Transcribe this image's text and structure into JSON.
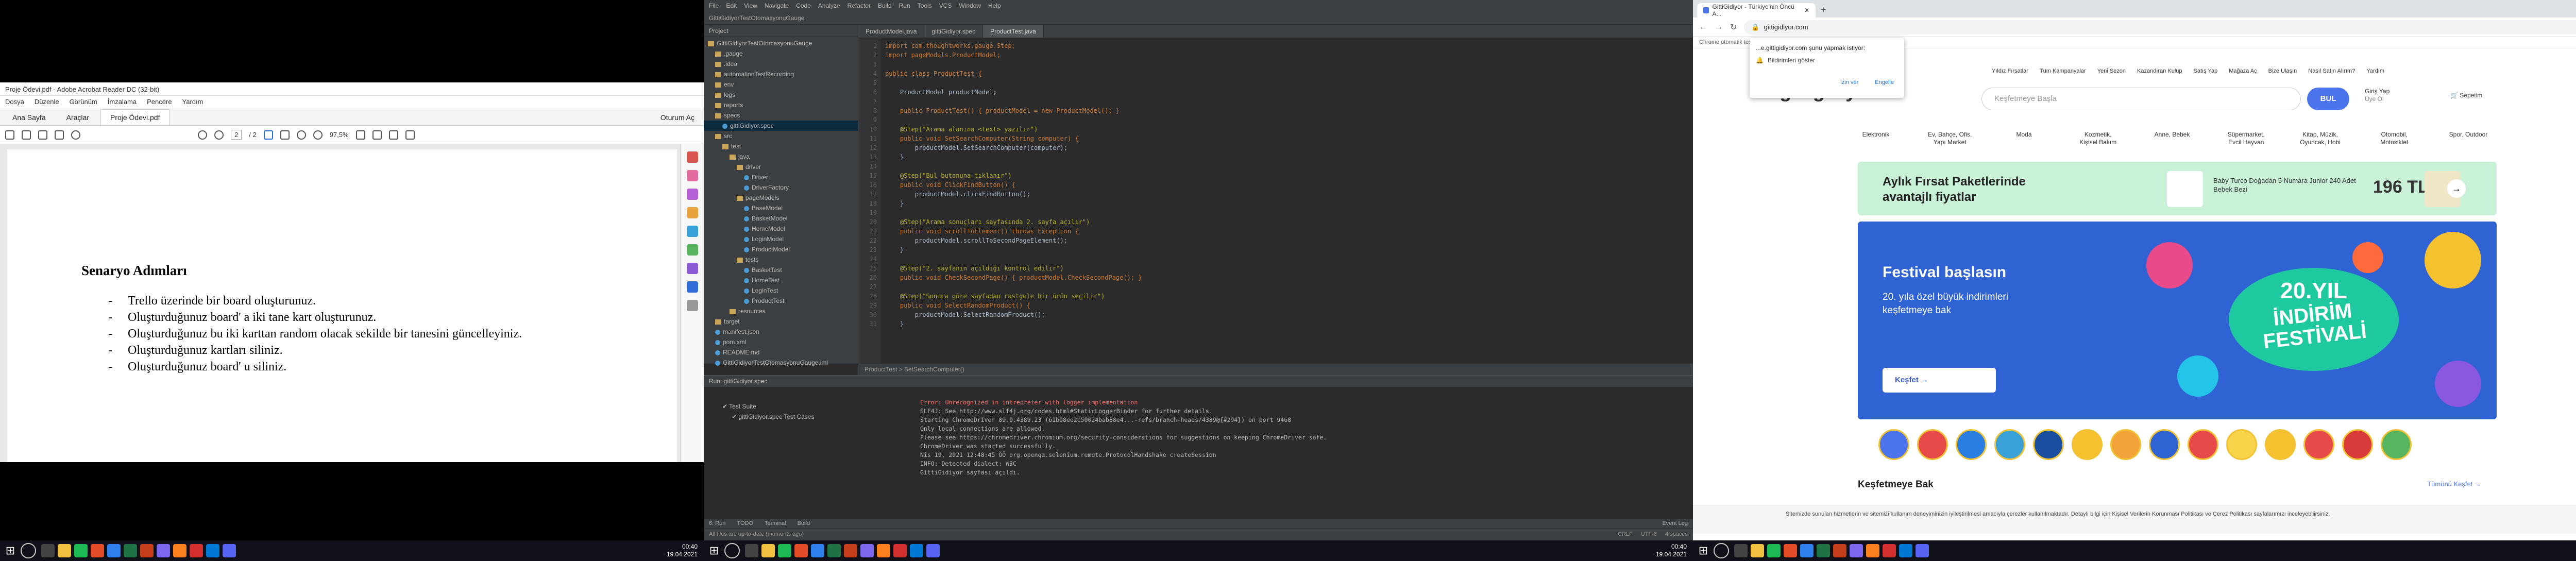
{
  "pdf": {
    "window_title": "Proje Ödevi.pdf - Adobe Acrobat Reader DC (32-bit)",
    "menu": [
      "Dosya",
      "Düzenle",
      "Görünüm",
      "İmzalama",
      "Pencere",
      "Yardım"
    ],
    "tabs": [
      "Ana Sayfa",
      "Araçlar",
      "Proje Ödevi.pdf"
    ],
    "signin": "Oturum Aç",
    "page_current": "2",
    "page_total": "/ 2",
    "zoom": "97,5%",
    "heading": "Senaryo Adımları",
    "steps": [
      "Trello üzerinde bir board oluşturunuz.",
      "Oluşturduğunuz board' a iki tane kart oluşturunuz.",
      "Oluşturduğunuz bu iki karttan random olacak sekilde bir tanesini güncelleyiniz.",
      "Oluşturduğunuz kartları siliniz.",
      "Oluşturduğunuz board' u siliniz."
    ],
    "bullet": "-"
  },
  "ide": {
    "menu": [
      "File",
      "Edit",
      "View",
      "Navigate",
      "Code",
      "Analyze",
      "Refactor",
      "Build",
      "Run",
      "Tools",
      "VCS",
      "Window",
      "Help"
    ],
    "nav": "GittiGidiyorTestOtomasyonuGauge",
    "project_label": "Project",
    "tree": [
      {
        "label": "GittiGidiyorTestOtomasyonuGauge",
        "type": "folder",
        "depth": 0
      },
      {
        "label": ".gauge",
        "type": "folder",
        "depth": 1
      },
      {
        "label": ".idea",
        "type": "folder",
        "depth": 1
      },
      {
        "label": "automationTestRecording",
        "type": "folder",
        "depth": 1
      },
      {
        "label": "env",
        "type": "folder",
        "depth": 1
      },
      {
        "label": "logs",
        "type": "folder",
        "depth": 1
      },
      {
        "label": "reports",
        "type": "folder",
        "depth": 1
      },
      {
        "label": "specs",
        "type": "folder",
        "depth": 1
      },
      {
        "label": "gittiGidiyor.spec",
        "type": "file",
        "depth": 2,
        "selected": true
      },
      {
        "label": "src",
        "type": "folder",
        "depth": 1
      },
      {
        "label": "test",
        "type": "folder",
        "depth": 2
      },
      {
        "label": "java",
        "type": "folder",
        "depth": 3
      },
      {
        "label": "driver",
        "type": "folder",
        "depth": 4
      },
      {
        "label": "Driver",
        "type": "file",
        "depth": 5
      },
      {
        "label": "DriverFactory",
        "type": "file",
        "depth": 5
      },
      {
        "label": "pageModels",
        "type": "folder",
        "depth": 4
      },
      {
        "label": "BaseModel",
        "type": "file",
        "depth": 5
      },
      {
        "label": "BasketModel",
        "type": "file",
        "depth": 5
      },
      {
        "label": "HomeModel",
        "type": "file",
        "depth": 5
      },
      {
        "label": "LoginModel",
        "type": "file",
        "depth": 5
      },
      {
        "label": "ProductModel",
        "type": "file",
        "depth": 5
      },
      {
        "label": "tests",
        "type": "folder",
        "depth": 4
      },
      {
        "label": "BasketTest",
        "type": "file",
        "depth": 5
      },
      {
        "label": "HomeTest",
        "type": "file",
        "depth": 5
      },
      {
        "label": "LoginTest",
        "type": "file",
        "depth": 5
      },
      {
        "label": "ProductTest",
        "type": "file",
        "depth": 5
      },
      {
        "label": "resources",
        "type": "folder",
        "depth": 3
      },
      {
        "label": "target",
        "type": "folder",
        "depth": 1
      },
      {
        "label": "manifest.json",
        "type": "file",
        "depth": 1
      },
      {
        "label": "pom.xml",
        "type": "file",
        "depth": 1
      },
      {
        "label": "README.md",
        "type": "file",
        "depth": 1
      },
      {
        "label": "GittiGidiyorTestOtomasyonuGauge.iml",
        "type": "file",
        "depth": 1
      }
    ],
    "tabs": [
      "ProductModel.java",
      "gittiGidiyor.spec",
      "ProductTest.java"
    ],
    "active_tab": 2,
    "code": [
      "import com.thoughtworks.gauge.Step;",
      "import pageModels.ProductModel;",
      "",
      "public class ProductTest {",
      "",
      "    ProductModel productModel;",
      "",
      "    public ProductTest() { productModel = new ProductModel(); }",
      "",
      "    @Step(\"Arama alanına <text> yazılır\")",
      "    public void SetSearchComputer(String computer) {",
      "        productModel.SetSearchComputer(computer);",
      "    }",
      "",
      "    @Step(\"Bul butonuna tıklanır\")",
      "    public void ClickFindButton() {",
      "        productModel.clickFindButton();",
      "    }",
      "",
      "    @Step(\"Arama sonuçları sayfasında 2. sayfa açılır\")",
      "    public void scrollToElement() throws Exception {",
      "        productModel.scrollToSecondPageElement();",
      "    }",
      "",
      "    @Step(\"2. sayfanın açıldığı kontrol edilir\")",
      "    public void CheckSecondPage() { productModel.CheckSecondPage(); }",
      "",
      "    @Step(\"Sonuca göre sayfadan rastgele bir ürün seçilir\")",
      "    public void SelectRandomProduct() {",
      "        productModel.SelectRandomProduct();",
      "    }"
    ],
    "breadcrumb": "ProductTest > SetSearchComputer()",
    "run_title": "Run: gittiGidiyor.spec",
    "run_tree": [
      "Test Suite",
      "gittiGidiyor.spec Test Cases"
    ],
    "run_output": [
      "Error: Unrecognized in intrepreter with logger implementation",
      "SLF4J: See http://www.slf4j.org/codes.html#StaticLoggerBinder for further details.",
      "Starting ChromeDriver 89.0.4389.23 (61b08ee2c50024bab88e4...-refs/branch-heads/4389@{#294}) on port 9468",
      "Only local connections are allowed.",
      "Please see https://chromedriver.chromium.org/security-considerations for suggestions on keeping ChromeDriver safe.",
      "ChromeDriver was started successfully.",
      "Nis 19, 2021 12:48:45 ÖÖ org.openqa.selenium.remote.ProtocolHandshake createSession",
      "INFO: Detected dialect: W3C",
      "GittiGidiyor sayfası açıldı."
    ],
    "bottom_tools": [
      "6: Run",
      "TODO",
      "Terminal",
      "Build"
    ],
    "status": "All files are up-to-date (moments ago)",
    "status_right": [
      "CRLF",
      "UTF-8",
      "4 spaces"
    ],
    "event_log": "Event Log"
  },
  "browser": {
    "tab_title": "GittiGidiyor - Türkiye'nin Öncü A...",
    "url": "gittigidiyor.com",
    "bookmark": "Chrome otomatik test yazılımı tarafından kontrol ediliyor.",
    "notif_title": "...e.gittigidiyor.com şunu yapmak istiyor:",
    "notif_item": "Bildirimleri göster",
    "notif_allow": "İzin ver",
    "notif_block": "Engelle",
    "toplinks": [
      "Yıldız Fırsatlar",
      "Tüm Kampanyalar",
      "Yeni Sezon",
      "Kazandıran Kulüp",
      "Satış Yap",
      "Mağaza Aç",
      "Bize Ulaşın",
      "Nasıl Satın Alırım?",
      "Yardım"
    ],
    "logo": "gittigidiyor",
    "search_placeholder": "Keşfetmeye Başla",
    "search_button": "BUL",
    "account": [
      "Giriş Yap",
      "Üye Ol"
    ],
    "cart": "Sepetim",
    "categories": [
      "Elektronik",
      "Ev, Bahçe, Ofis, Yapı Market",
      "Moda",
      "Kozmetik, Kişisel Bakım",
      "Anne, Bebek",
      "Süpermarket, Evcil Hayvan",
      "Kitap, Müzik, Oyuncak, Hobi",
      "Otomobil, Motosiklet",
      "Spor, Outdoor"
    ],
    "promo_title": "Aylık Fırsat Paketlerinde avantajlı fiyatlar",
    "promo_item": "Baby Turco Doğadan 5 Numara Junior 240 Adet Bebek Bezi",
    "promo_price": "196 TL",
    "fest_title": "Festival başlasın",
    "fest_sub": "20. yıla özel büyük indirimleri keşfetmeye bak",
    "fest_badge_a": "20.YIL",
    "fest_badge_b": "İNDİRİM FESTİVALİ",
    "fest_button": "Keşfet",
    "kesfet_title": "Keşfetmeye Bak",
    "kesfet_link": "Tümünü Keşfet",
    "cookie": "Sitemizde sunulan hizmetlerin ve sitemizi kullanım deneyiminizin iyileştirilmesi amacıyla çerezler kullanılmaktadır. Detaylı bilgi için Kişisel Verilerin Korunması Politikası ve Çerez Politikası sayfalarımızı inceleyebilirsiniz."
  },
  "taskbar": {
    "time": "00:40",
    "date": "19.04.2021"
  },
  "colors": {
    "ide_bg": "#2b2b2b",
    "brand": "#4b73ec",
    "promo": "#c8f1d7",
    "fest": "#2f62d3"
  }
}
